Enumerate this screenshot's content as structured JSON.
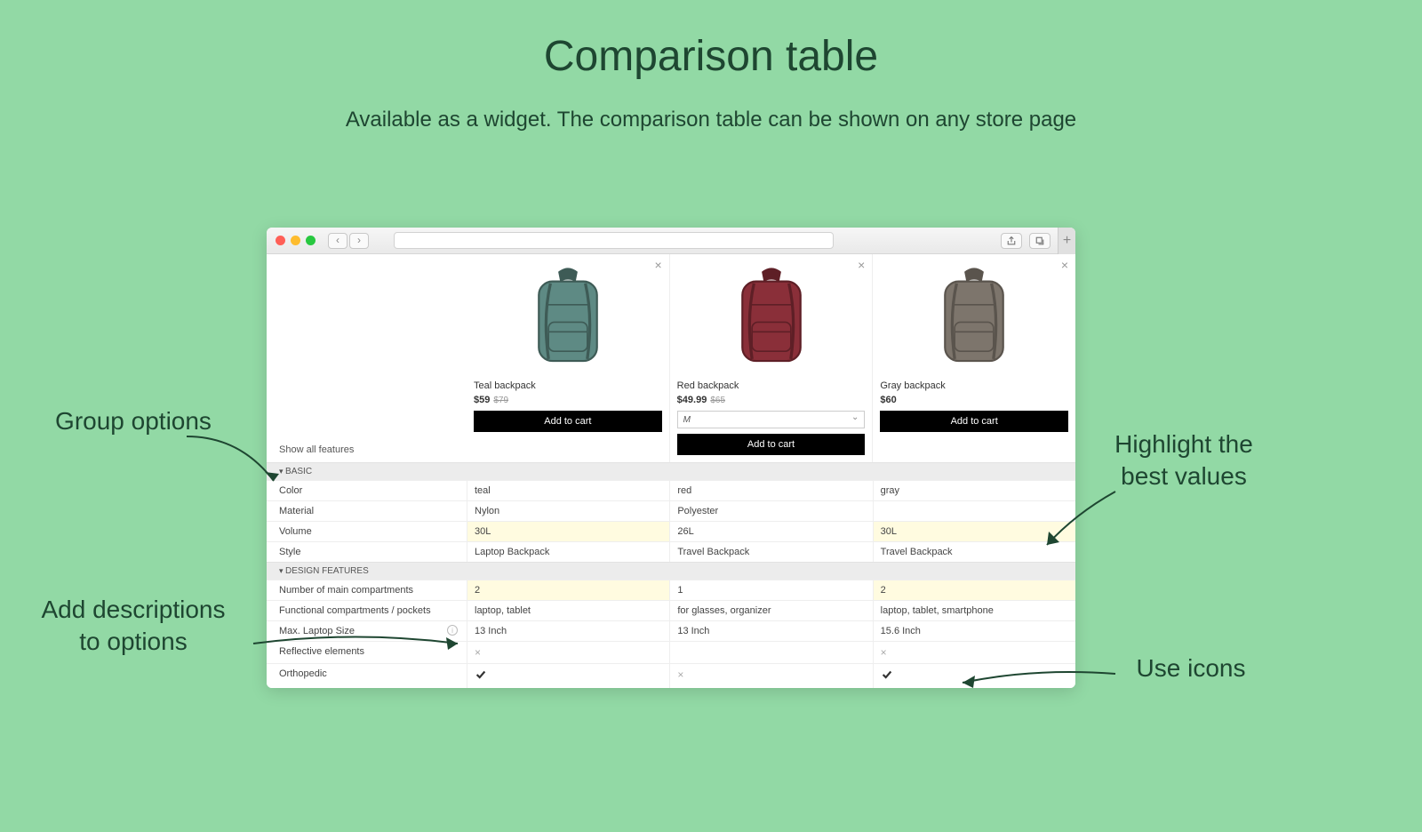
{
  "header": {
    "title": "Comparison table",
    "subtitle": "Available as a widget. The comparison table can be shown on any store page"
  },
  "actions": {
    "show_all": "Show all features",
    "add_to_cart": "Add to cart"
  },
  "products": [
    {
      "name": "Teal backpack",
      "price": "$59",
      "old_price": "$79",
      "size": null,
      "color_body": "#5e8a84",
      "color_accent": "#3e5b56"
    },
    {
      "name": "Red backpack",
      "price": "$49.99",
      "old_price": "$65",
      "size": "M",
      "color_body": "#8a2f39",
      "color_accent": "#5e1f26"
    },
    {
      "name": "Gray backpack",
      "price": "$60",
      "old_price": null,
      "size": null,
      "color_body": "#7d756c",
      "color_accent": "#5a544d"
    }
  ],
  "groups": [
    {
      "name": "BASIC",
      "rows": [
        {
          "label": "Color",
          "values": [
            "teal",
            "red",
            "gray"
          ],
          "best": []
        },
        {
          "label": "Material",
          "values": [
            "Nylon",
            "Polyester",
            ""
          ],
          "best": []
        },
        {
          "label": "Volume",
          "values": [
            "30L",
            "26L",
            "30L"
          ],
          "best": [
            0,
            2
          ]
        },
        {
          "label": "Style",
          "values": [
            "Laptop Backpack",
            "Travel Backpack",
            "Travel Backpack"
          ],
          "best": []
        }
      ]
    },
    {
      "name": "DESIGN FEATURES",
      "rows": [
        {
          "label": "Number of main compartments",
          "values": [
            "2",
            "1",
            "2"
          ],
          "best": [
            0,
            2
          ]
        },
        {
          "label": "Functional compartments / pockets",
          "values": [
            "laptop, tablet",
            "for glasses, organizer",
            "laptop, tablet, smartphone"
          ],
          "best": []
        },
        {
          "label": "Max. Laptop Size",
          "values": [
            "13 Inch",
            "13 Inch",
            "15.6 Inch"
          ],
          "best": [],
          "has_info": true
        },
        {
          "label": "Reflective elements",
          "values": [
            "x",
            "",
            "x"
          ],
          "type": "icon",
          "best": []
        },
        {
          "label": "Orthopedic",
          "values": [
            "check",
            "x",
            "check"
          ],
          "type": "icon",
          "best": []
        }
      ]
    }
  ],
  "callouts": {
    "group": "Group options",
    "desc": "Add descriptions\nto options",
    "best": "Highlight the\nbest values",
    "icons": "Use icons"
  }
}
